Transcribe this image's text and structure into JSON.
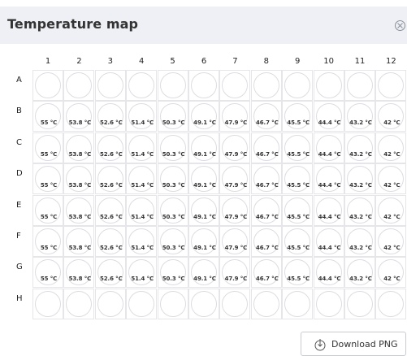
{
  "dialog": {
    "title": "Temperature map",
    "close_icon": "close-circle-icon"
  },
  "plate": {
    "columns": [
      "1",
      "2",
      "3",
      "4",
      "5",
      "6",
      "7",
      "8",
      "9",
      "10",
      "11",
      "12"
    ],
    "rows": [
      {
        "label": "A",
        "temps": [
          "",
          "",
          "",
          "",
          "",
          "",
          "",
          "",
          "",
          "",
          "",
          ""
        ]
      },
      {
        "label": "B",
        "temps": [
          "55 °C",
          "53.8 °C",
          "52.6 °C",
          "51.4 °C",
          "50.3 °C",
          "49.1 °C",
          "47.9 °C",
          "46.7 °C",
          "45.5 °C",
          "44.4 °C",
          "43.2 °C",
          "42 °C"
        ]
      },
      {
        "label": "C",
        "temps": [
          "55 °C",
          "53.8 °C",
          "52.6 °C",
          "51.4 °C",
          "50.3 °C",
          "49.1 °C",
          "47.9 °C",
          "46.7 °C",
          "45.5 °C",
          "44.4 °C",
          "43.2 °C",
          "42 °C"
        ]
      },
      {
        "label": "D",
        "temps": [
          "55 °C",
          "53.8 °C",
          "52.6 °C",
          "51.4 °C",
          "50.3 °C",
          "49.1 °C",
          "47.9 °C",
          "46.7 °C",
          "45.5 °C",
          "44.4 °C",
          "43.2 °C",
          "42 °C"
        ]
      },
      {
        "label": "E",
        "temps": [
          "55 °C",
          "53.8 °C",
          "52.6 °C",
          "51.4 °C",
          "50.3 °C",
          "49.1 °C",
          "47.9 °C",
          "46.7 °C",
          "45.5 °C",
          "44.4 °C",
          "43.2 °C",
          "42 °C"
        ]
      },
      {
        "label": "F",
        "temps": [
          "55 °C",
          "53.8 °C",
          "52.6 °C",
          "51.4 °C",
          "50.3 °C",
          "49.1 °C",
          "47.9 °C",
          "46.7 °C",
          "45.5 °C",
          "44.4 °C",
          "43.2 °C",
          "42 °C"
        ]
      },
      {
        "label": "G",
        "temps": [
          "55 °C",
          "53.8 °C",
          "52.6 °C",
          "51.4 °C",
          "50.3 °C",
          "49.1 °C",
          "47.9 °C",
          "46.7 °C",
          "45.5 °C",
          "44.4 °C",
          "43.2 °C",
          "42 °C"
        ]
      },
      {
        "label": "H",
        "temps": [
          "",
          "",
          "",
          "",
          "",
          "",
          "",
          "",
          "",
          "",
          "",
          ""
        ]
      }
    ]
  },
  "footer": {
    "download_label": "Download PNG",
    "download_icon": "download-icon"
  },
  "colors": {
    "header_bg": "#eef0f5",
    "well_border": "#dcdde2",
    "text": "#333333"
  }
}
